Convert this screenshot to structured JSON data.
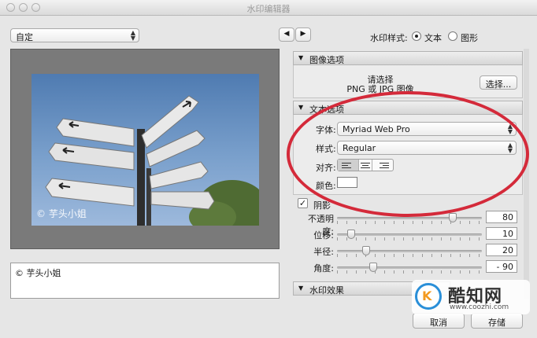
{
  "window": {
    "title": "水印编辑器"
  },
  "preset": {
    "value": "自定"
  },
  "nav": {
    "prev": "◀",
    "next": "▶"
  },
  "style": {
    "label": "水印样式:",
    "opt_text": "文本",
    "opt_graphic": "图形",
    "selected": "文本"
  },
  "image_options": {
    "header": "图像选项",
    "hint_line1": "请选择",
    "hint_line2": "PNG 或 JPG 图像",
    "choose_label": "选择..."
  },
  "text_options": {
    "header": "文本选项",
    "font_label": "字体:",
    "font_value": "Myriad Web Pro",
    "style_label": "样式:",
    "style_value": "Regular",
    "align_label": "对齐:",
    "color_label": "颜色:",
    "color_value": "#ffffff"
  },
  "shadow": {
    "label": "阴影",
    "checked": true,
    "check_glyph": "✓",
    "rows": [
      {
        "label": "不透明度:",
        "value": "80",
        "level": 0.8
      },
      {
        "label": "位移:",
        "value": "10",
        "level": 0.1
      },
      {
        "label": "半径:",
        "value": "20",
        "level": 0.2
      },
      {
        "label": "角度:",
        "value": "- 90",
        "level": 0.25
      }
    ]
  },
  "effects": {
    "header": "水印效果"
  },
  "preview": {
    "watermark_overlay": "© 芋头小姐"
  },
  "watermark_text": {
    "value": "© 芋头小姐"
  },
  "buttons": {
    "cancel": "取消",
    "save": "存储"
  },
  "corner_logo": {
    "name": "酷知网",
    "url": "www.coozhi.com"
  },
  "colors": {
    "accent": "#3478d6",
    "annotation": "#d42a3a",
    "logo_blue": "#2a8fd8",
    "logo_orange": "#f39a1f"
  }
}
